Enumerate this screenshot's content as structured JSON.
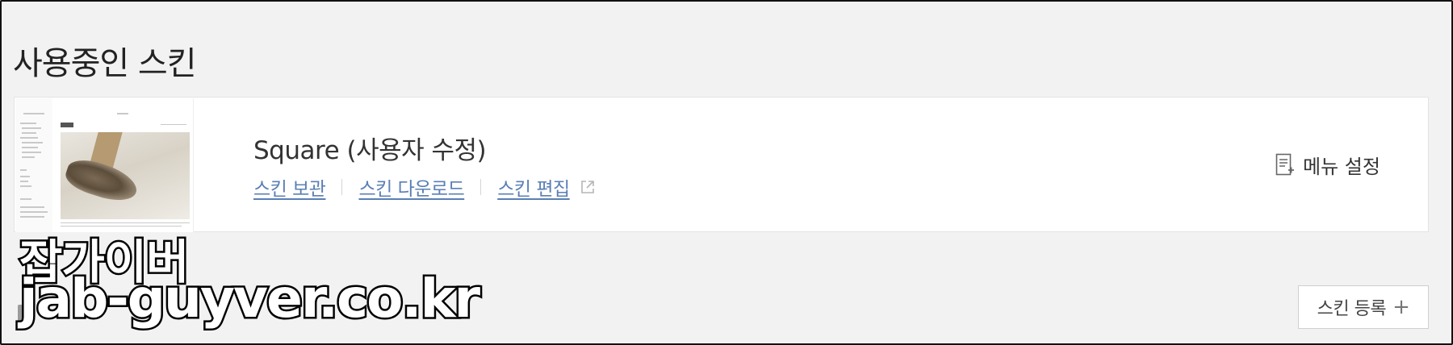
{
  "section": {
    "title": "사용중인 스킨"
  },
  "current_skin": {
    "name": "Square (사용자 수정)",
    "actions": [
      {
        "label": "스킨 보관"
      },
      {
        "label": "스킨 다운로드"
      },
      {
        "label": "스킨 편집",
        "icon": "external-link-icon"
      }
    ],
    "menu_setting": {
      "label": "메뉴 설정",
      "icon": "menu-setting-icon"
    }
  },
  "register_button": {
    "label": "스킨 등록",
    "icon": "+"
  },
  "watermark": {
    "name": "잡가이버",
    "url": "jab-guyver.co.kr"
  },
  "colors": {
    "background": "#f2f2f2",
    "card": "#ffffff",
    "link": "#5a7fb5",
    "text": "#333333"
  }
}
